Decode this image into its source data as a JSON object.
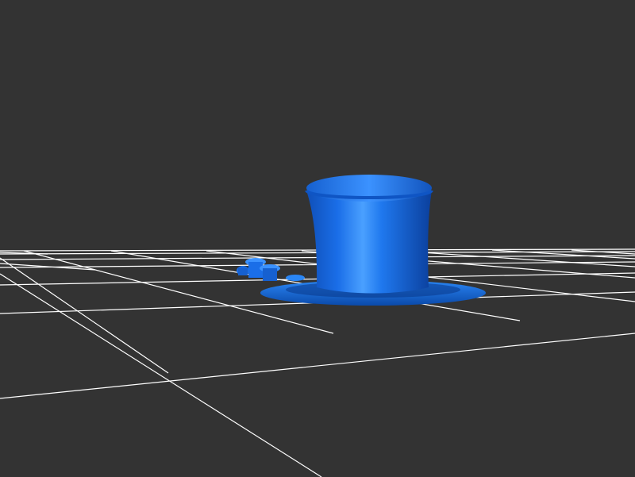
{
  "scene": {
    "background_color": "#333333",
    "grid_color": "#ffffff",
    "object_color": "#1a6ee8",
    "object_highlight_color": "#4aa0ff",
    "object_shadow_color": "#0b3f9c",
    "objects": [
      {
        "name": "top-hat",
        "kind": "3d-model"
      },
      {
        "name": "small-buttons",
        "kind": "3d-model"
      }
    ]
  }
}
